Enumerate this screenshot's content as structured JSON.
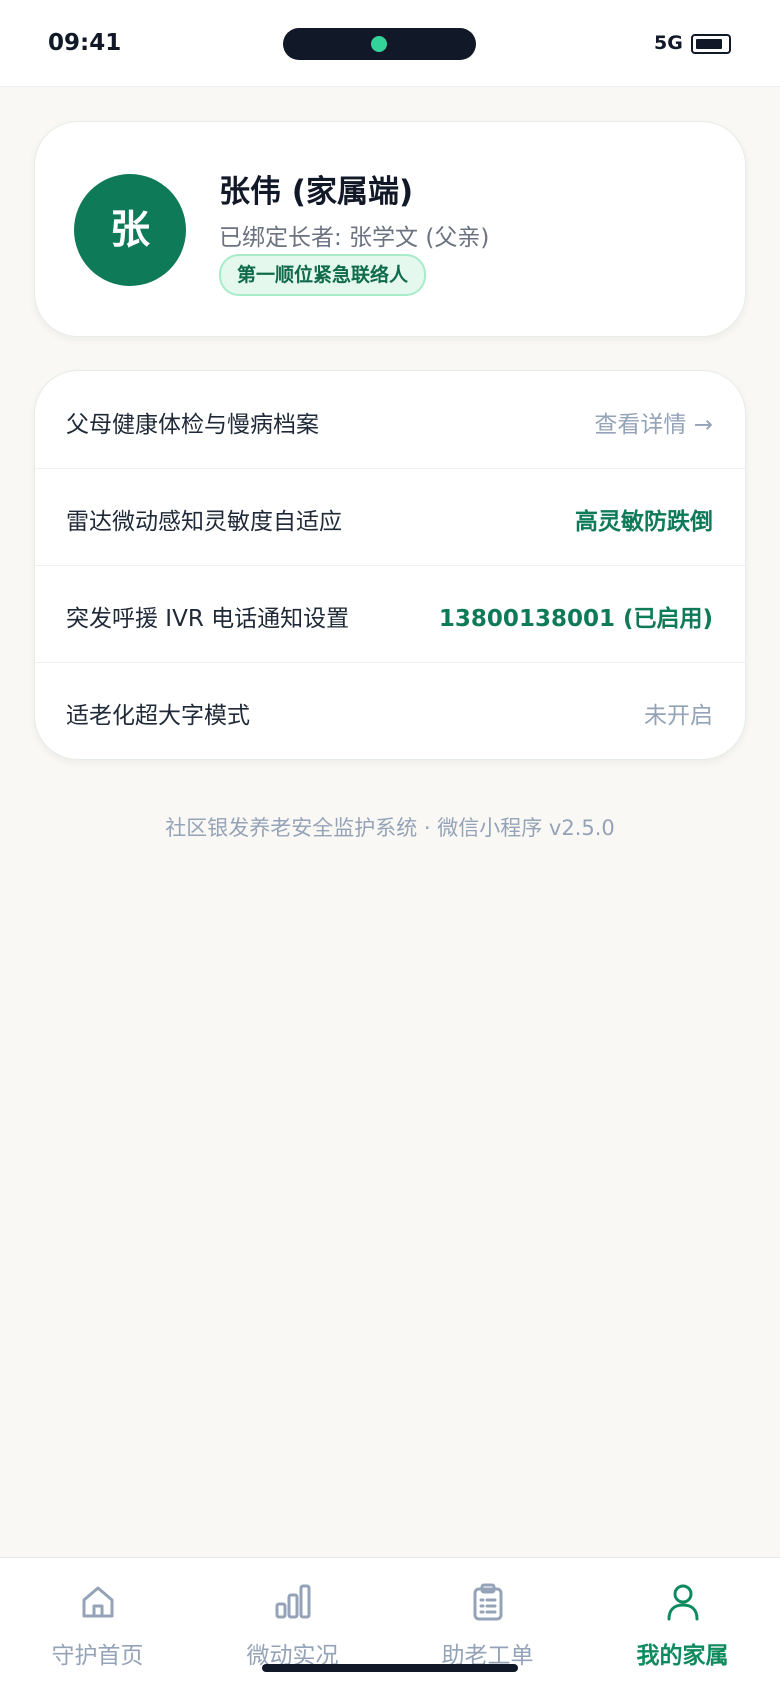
{
  "status_bar": {
    "time": "09:41",
    "network": "5G"
  },
  "profile": {
    "avatar_initial": "张",
    "name": "张伟 (家属端)",
    "bound_elder": "已绑定长者: 张学文 (父亲)",
    "role_badge": "第一顺位紧急联络人"
  },
  "settings": [
    {
      "label": "父母健康体检与慢病档案",
      "value": "查看详情 →",
      "style": "gray"
    },
    {
      "label": "雷达微动感知灵敏度自适应",
      "value": "高灵敏防跌倒",
      "style": "green"
    },
    {
      "label": "突发呼援 IVR 电话通知设置",
      "value": "13800138001 (已启用)",
      "style": "green"
    },
    {
      "label": "适老化超大字模式",
      "value": "未开启",
      "style": "gray"
    }
  ],
  "footer_note": "社区银发养老安全监护系统 · 微信小程序 v2.5.0",
  "tabs": [
    {
      "label": "守护首页",
      "icon": "home-icon",
      "active": false
    },
    {
      "label": "微动实况",
      "icon": "bar-chart-icon",
      "active": false
    },
    {
      "label": "助老工单",
      "icon": "clipboard-icon",
      "active": false
    },
    {
      "label": "我的家属",
      "icon": "user-icon",
      "active": true
    }
  ],
  "colors": {
    "accent": "#0f7a57",
    "active_tab": "#0f8a5f",
    "muted": "#94a3b8",
    "background": "#faf8f4"
  }
}
